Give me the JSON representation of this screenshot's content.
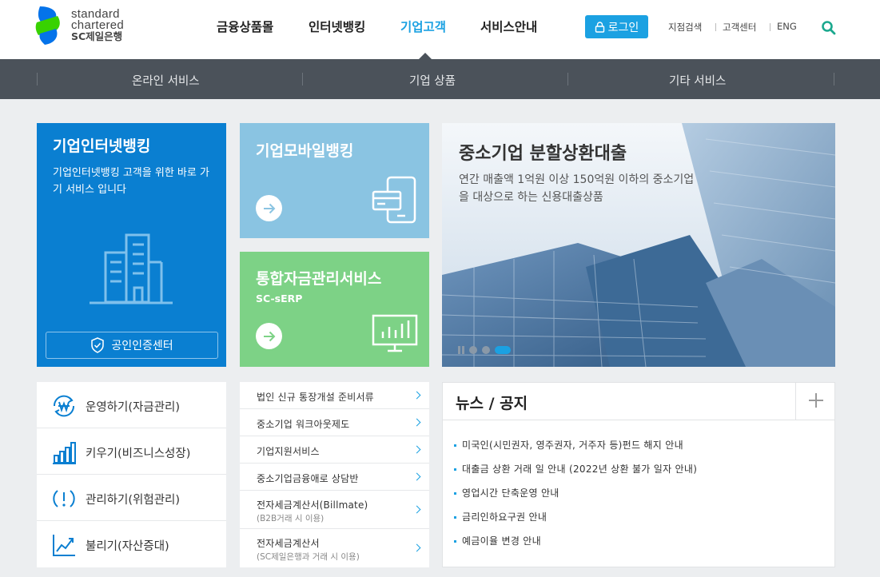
{
  "header": {
    "logo": {
      "line1": "standard",
      "line2": "chartered",
      "line3": "SC제일은행"
    },
    "gnb": [
      "금융상품몰",
      "인터넷뱅킹",
      "기업고객",
      "서비스안내"
    ],
    "login": "로그인",
    "util": [
      "지점검색",
      "고객센터",
      "ENG"
    ]
  },
  "subnav": [
    "온라인 서비스",
    "기업 상품",
    "기타 서비스"
  ],
  "tiles": {
    "internet_banking": {
      "title": "기업인터넷뱅킹",
      "desc": "기업인터넷뱅킹 고객을 위한 바로 가기 서비스 입니다",
      "cert": "공인인증센터"
    },
    "mobile_banking": {
      "title": "기업모바일뱅킹"
    },
    "erp": {
      "title": "통합자금관리서비스",
      "sub": "SC-sERP"
    }
  },
  "banner": {
    "title": "중소기업 분할상환대출",
    "desc": "연간 매출액 1억원 이상 150억원 이하의 중소기업을 대상으로 하는 신용대출상품"
  },
  "quick_menu": [
    "운영하기(자금관리)",
    "키우기(비즈니스성장)",
    "관리하기(위험관리)",
    "불리기(자산증대)"
  ],
  "links": [
    {
      "label": "법인 신규 통장개설 준비서류",
      "sub": ""
    },
    {
      "label": "중소기업 워크아웃제도",
      "sub": ""
    },
    {
      "label": "기업지원서비스",
      "sub": ""
    },
    {
      "label": "중소기업금융애로 상담반",
      "sub": ""
    },
    {
      "label": "전자세금계산서(Billmate)",
      "sub": "(B2B거래 시 이용)"
    },
    {
      "label": "전자세금계산서",
      "sub": "(SC제일은행과 거래 시 이용)"
    }
  ],
  "news": {
    "title": "뉴스 / 공지",
    "items": [
      "미국인(시민권자, 영주권자, 거주자 등)펀드 해지 안내",
      "대출금 상환 거래 일 안내 (2022년 상환 불가 일자 안내)",
      "영업시간 단축운영 안내",
      "금리인하요구권 안내",
      "예금이율 변경 안내"
    ]
  },
  "colors": {
    "accent": "#1ba1e2",
    "ib_tile": "#0a7fd1",
    "mb_tile": "#8ac4e2",
    "erp_tile": "#7dd286",
    "subnav": "#4b525a"
  }
}
